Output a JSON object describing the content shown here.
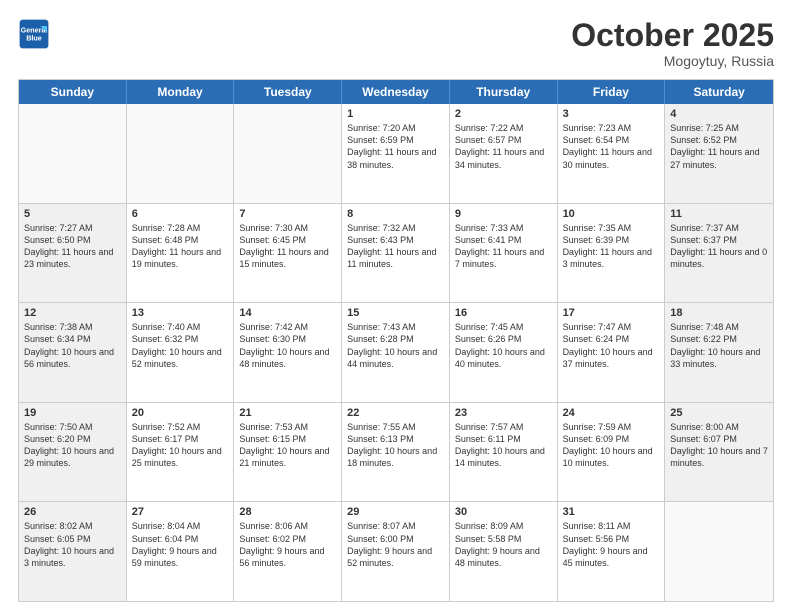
{
  "logo": {
    "line1": "General",
    "line2": "Blue"
  },
  "title": "October 2025",
  "location": "Mogoytuy, Russia",
  "days_of_week": [
    "Sunday",
    "Monday",
    "Tuesday",
    "Wednesday",
    "Thursday",
    "Friday",
    "Saturday"
  ],
  "rows": [
    [
      {
        "day": "",
        "info": "",
        "empty": true
      },
      {
        "day": "",
        "info": "",
        "empty": true
      },
      {
        "day": "",
        "info": "",
        "empty": true
      },
      {
        "day": "1",
        "info": "Sunrise: 7:20 AM\nSunset: 6:59 PM\nDaylight: 11 hours\nand 38 minutes."
      },
      {
        "day": "2",
        "info": "Sunrise: 7:22 AM\nSunset: 6:57 PM\nDaylight: 11 hours\nand 34 minutes."
      },
      {
        "day": "3",
        "info": "Sunrise: 7:23 AM\nSunset: 6:54 PM\nDaylight: 11 hours\nand 30 minutes."
      },
      {
        "day": "4",
        "info": "Sunrise: 7:25 AM\nSunset: 6:52 PM\nDaylight: 11 hours\nand 27 minutes.",
        "shaded": true
      }
    ],
    [
      {
        "day": "5",
        "info": "Sunrise: 7:27 AM\nSunset: 6:50 PM\nDaylight: 11 hours\nand 23 minutes.",
        "shaded": true
      },
      {
        "day": "6",
        "info": "Sunrise: 7:28 AM\nSunset: 6:48 PM\nDaylight: 11 hours\nand 19 minutes."
      },
      {
        "day": "7",
        "info": "Sunrise: 7:30 AM\nSunset: 6:45 PM\nDaylight: 11 hours\nand 15 minutes."
      },
      {
        "day": "8",
        "info": "Sunrise: 7:32 AM\nSunset: 6:43 PM\nDaylight: 11 hours\nand 11 minutes."
      },
      {
        "day": "9",
        "info": "Sunrise: 7:33 AM\nSunset: 6:41 PM\nDaylight: 11 hours\nand 7 minutes."
      },
      {
        "day": "10",
        "info": "Sunrise: 7:35 AM\nSunset: 6:39 PM\nDaylight: 11 hours\nand 3 minutes."
      },
      {
        "day": "11",
        "info": "Sunrise: 7:37 AM\nSunset: 6:37 PM\nDaylight: 11 hours\nand 0 minutes.",
        "shaded": true
      }
    ],
    [
      {
        "day": "12",
        "info": "Sunrise: 7:38 AM\nSunset: 6:34 PM\nDaylight: 10 hours\nand 56 minutes.",
        "shaded": true
      },
      {
        "day": "13",
        "info": "Sunrise: 7:40 AM\nSunset: 6:32 PM\nDaylight: 10 hours\nand 52 minutes."
      },
      {
        "day": "14",
        "info": "Sunrise: 7:42 AM\nSunset: 6:30 PM\nDaylight: 10 hours\nand 48 minutes."
      },
      {
        "day": "15",
        "info": "Sunrise: 7:43 AM\nSunset: 6:28 PM\nDaylight: 10 hours\nand 44 minutes."
      },
      {
        "day": "16",
        "info": "Sunrise: 7:45 AM\nSunset: 6:26 PM\nDaylight: 10 hours\nand 40 minutes."
      },
      {
        "day": "17",
        "info": "Sunrise: 7:47 AM\nSunset: 6:24 PM\nDaylight: 10 hours\nand 37 minutes."
      },
      {
        "day": "18",
        "info": "Sunrise: 7:48 AM\nSunset: 6:22 PM\nDaylight: 10 hours\nand 33 minutes.",
        "shaded": true
      }
    ],
    [
      {
        "day": "19",
        "info": "Sunrise: 7:50 AM\nSunset: 6:20 PM\nDaylight: 10 hours\nand 29 minutes.",
        "shaded": true
      },
      {
        "day": "20",
        "info": "Sunrise: 7:52 AM\nSunset: 6:17 PM\nDaylight: 10 hours\nand 25 minutes."
      },
      {
        "day": "21",
        "info": "Sunrise: 7:53 AM\nSunset: 6:15 PM\nDaylight: 10 hours\nand 21 minutes."
      },
      {
        "day": "22",
        "info": "Sunrise: 7:55 AM\nSunset: 6:13 PM\nDaylight: 10 hours\nand 18 minutes."
      },
      {
        "day": "23",
        "info": "Sunrise: 7:57 AM\nSunset: 6:11 PM\nDaylight: 10 hours\nand 14 minutes."
      },
      {
        "day": "24",
        "info": "Sunrise: 7:59 AM\nSunset: 6:09 PM\nDaylight: 10 hours\nand 10 minutes."
      },
      {
        "day": "25",
        "info": "Sunrise: 8:00 AM\nSunset: 6:07 PM\nDaylight: 10 hours\nand 7 minutes.",
        "shaded": true
      }
    ],
    [
      {
        "day": "26",
        "info": "Sunrise: 8:02 AM\nSunset: 6:05 PM\nDaylight: 10 hours\nand 3 minutes.",
        "shaded": true
      },
      {
        "day": "27",
        "info": "Sunrise: 8:04 AM\nSunset: 6:04 PM\nDaylight: 9 hours\nand 59 minutes."
      },
      {
        "day": "28",
        "info": "Sunrise: 8:06 AM\nSunset: 6:02 PM\nDaylight: 9 hours\nand 56 minutes."
      },
      {
        "day": "29",
        "info": "Sunrise: 8:07 AM\nSunset: 6:00 PM\nDaylight: 9 hours\nand 52 minutes."
      },
      {
        "day": "30",
        "info": "Sunrise: 8:09 AM\nSunset: 5:58 PM\nDaylight: 9 hours\nand 48 minutes."
      },
      {
        "day": "31",
        "info": "Sunrise: 8:11 AM\nSunset: 5:56 PM\nDaylight: 9 hours\nand 45 minutes."
      },
      {
        "day": "",
        "info": "",
        "empty": true
      }
    ]
  ]
}
